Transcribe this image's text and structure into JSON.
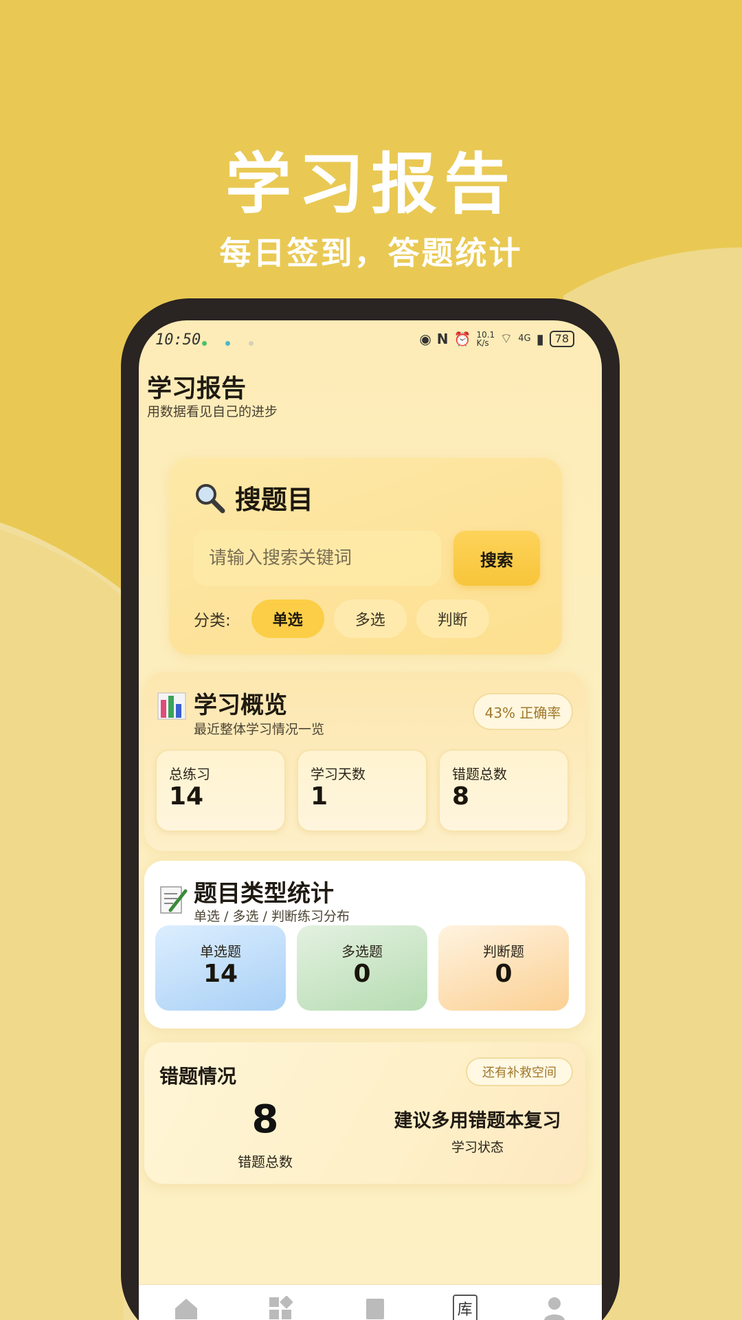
{
  "hero": {
    "title": "学习报告",
    "subtitle": "每日签到，答题统计"
  },
  "status_bar": {
    "time": "10:50",
    "network_speed": "10.1 K/s",
    "network_type": "4G",
    "battery": "78",
    "icons": [
      "eye-icon",
      "nfc-icon",
      "alarm-icon",
      "wifi-icon",
      "signal-icon",
      "battery-icon"
    ]
  },
  "header": {
    "title": "学习报告",
    "subtitle": "用数据看见自己的进步"
  },
  "search": {
    "title": "搜题目",
    "placeholder": "请输入搜索关键词",
    "button_label": "搜索",
    "category_label": "分类:",
    "categories": [
      "单选",
      "多选",
      "判断"
    ],
    "selected_category": "单选"
  },
  "overview": {
    "title": "学习概览",
    "subtitle": "最近整体学习情况一览",
    "accuracy_badge": "43% 正确率",
    "stats": [
      {
        "label": "总练习",
        "value": "14"
      },
      {
        "label": "学习天数",
        "value": "1"
      },
      {
        "label": "错题总数",
        "value": "8"
      }
    ]
  },
  "types": {
    "title": "题目类型统计",
    "subtitle": "单选 / 多选 / 判断练习分布",
    "items": [
      {
        "label": "单选题",
        "value": "14"
      },
      {
        "label": "多选题",
        "value": "0"
      },
      {
        "label": "判断题",
        "value": "0"
      }
    ]
  },
  "wrong": {
    "title": "错题情况",
    "badge": "还有补救空间",
    "count": "8",
    "count_label": "错题总数",
    "advice": "建议多用错题本复习",
    "advice_label": "学习状态"
  },
  "bottom_nav": {
    "library_label": "库",
    "icons": [
      "home-icon",
      "apps-icon",
      "book-icon",
      "library-icon",
      "profile-icon"
    ]
  },
  "colors": {
    "background_top": "#e9c954",
    "accent": "#fcce47",
    "phone_frame": "#2a2422",
    "badge_text": "#a0782b"
  }
}
